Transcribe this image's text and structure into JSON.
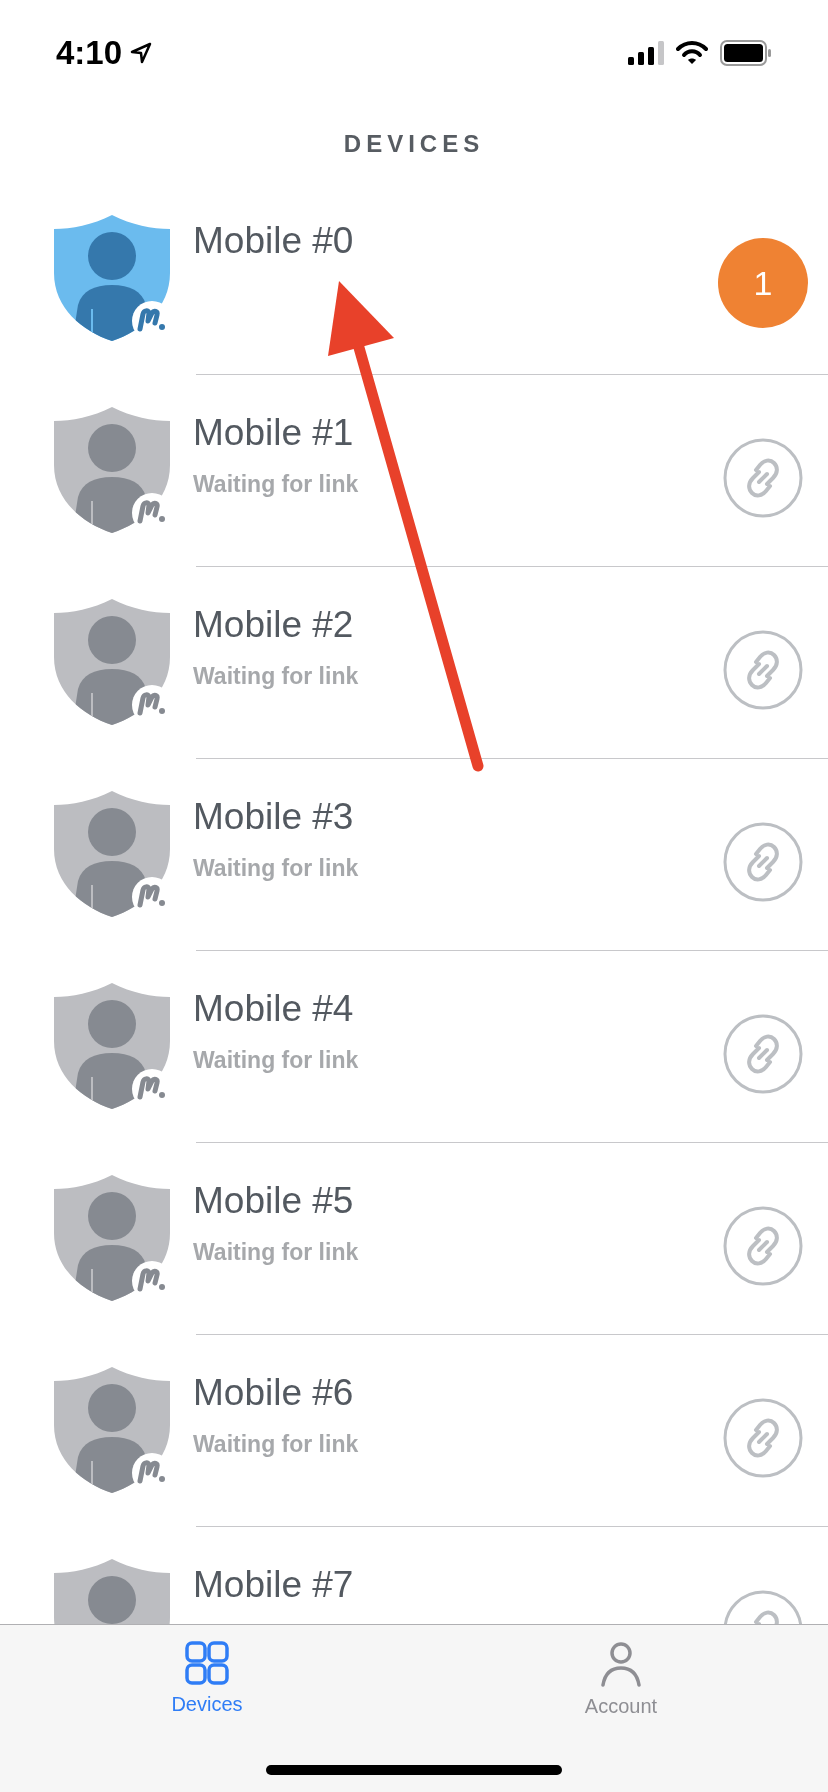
{
  "status_bar": {
    "time": "4:10"
  },
  "header": {
    "title": "DEVICES"
  },
  "devices": [
    {
      "name": "Mobile #0",
      "kind": "active",
      "badge": "1"
    },
    {
      "name": "Mobile #1",
      "kind": "waiting",
      "status": "Waiting for link"
    },
    {
      "name": "Mobile #2",
      "kind": "waiting",
      "status": "Waiting for link"
    },
    {
      "name": "Mobile #3",
      "kind": "waiting",
      "status": "Waiting for link"
    },
    {
      "name": "Mobile #4",
      "kind": "waiting",
      "status": "Waiting for link"
    },
    {
      "name": "Mobile #5",
      "kind": "waiting",
      "status": "Waiting for link"
    },
    {
      "name": "Mobile #6",
      "kind": "waiting",
      "status": "Waiting for link"
    },
    {
      "name": "Mobile #7",
      "kind": "waiting"
    }
  ],
  "tab_bar": [
    {
      "label": "Devices",
      "kind": "grid",
      "selected": true
    },
    {
      "label": "Account",
      "kind": "person",
      "selected": false
    }
  ]
}
